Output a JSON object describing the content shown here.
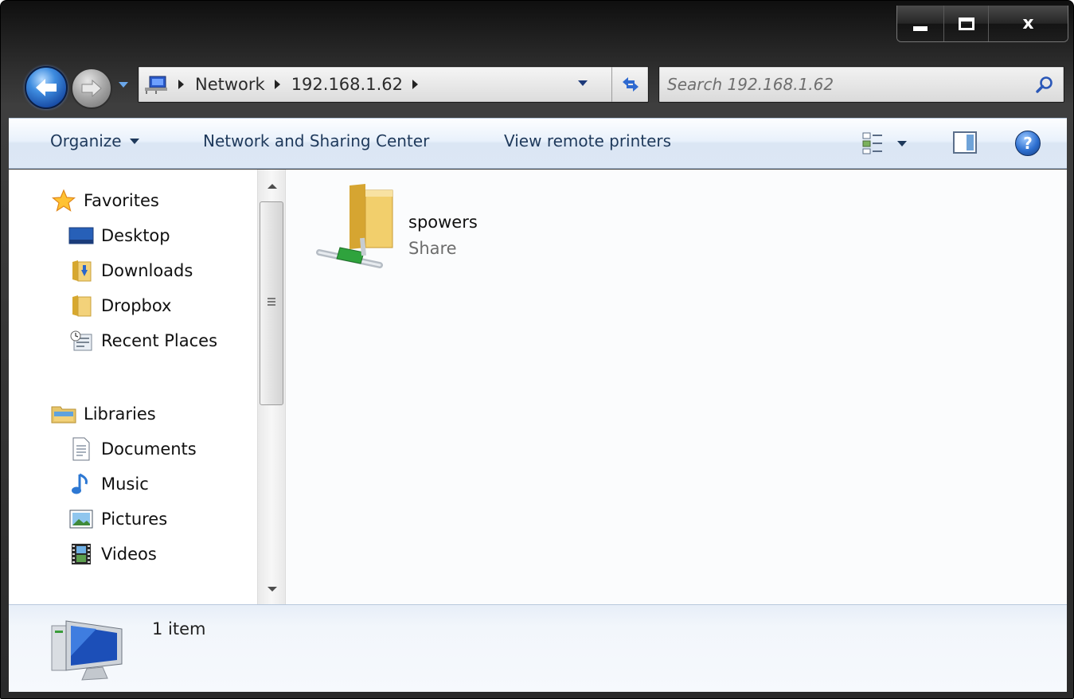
{
  "window": {
    "caption": {
      "minimize_icon": "minimize-icon",
      "maximize_icon": "maximize-icon",
      "close_glyph": "x"
    }
  },
  "nav": {
    "back_icon": "back-arrow-icon",
    "forward_icon": "forward-arrow-icon",
    "address": {
      "crumbs": [
        "Network",
        "192.168.1.62"
      ]
    },
    "search": {
      "placeholder": "Search 192.168.1.62"
    }
  },
  "toolbar": {
    "organize": "Organize",
    "network_sharing": "Network and Sharing Center",
    "view_printers": "View remote printers",
    "help": "?"
  },
  "sidebar": {
    "favorites": {
      "label": "Favorites",
      "items": [
        {
          "label": "Desktop"
        },
        {
          "label": "Downloads"
        },
        {
          "label": "Dropbox"
        },
        {
          "label": "Recent Places"
        }
      ]
    },
    "libraries": {
      "label": "Libraries",
      "items": [
        {
          "label": "Documents"
        },
        {
          "label": "Music"
        },
        {
          "label": "Pictures"
        },
        {
          "label": "Videos"
        }
      ]
    }
  },
  "content": {
    "items": [
      {
        "name": "spowers",
        "type": "Share"
      }
    ]
  },
  "details": {
    "count": "1 item"
  },
  "colors": {
    "accent": "#1e395b",
    "chrome": "#2a2a2a",
    "content_bg": "#fbfcfd"
  }
}
